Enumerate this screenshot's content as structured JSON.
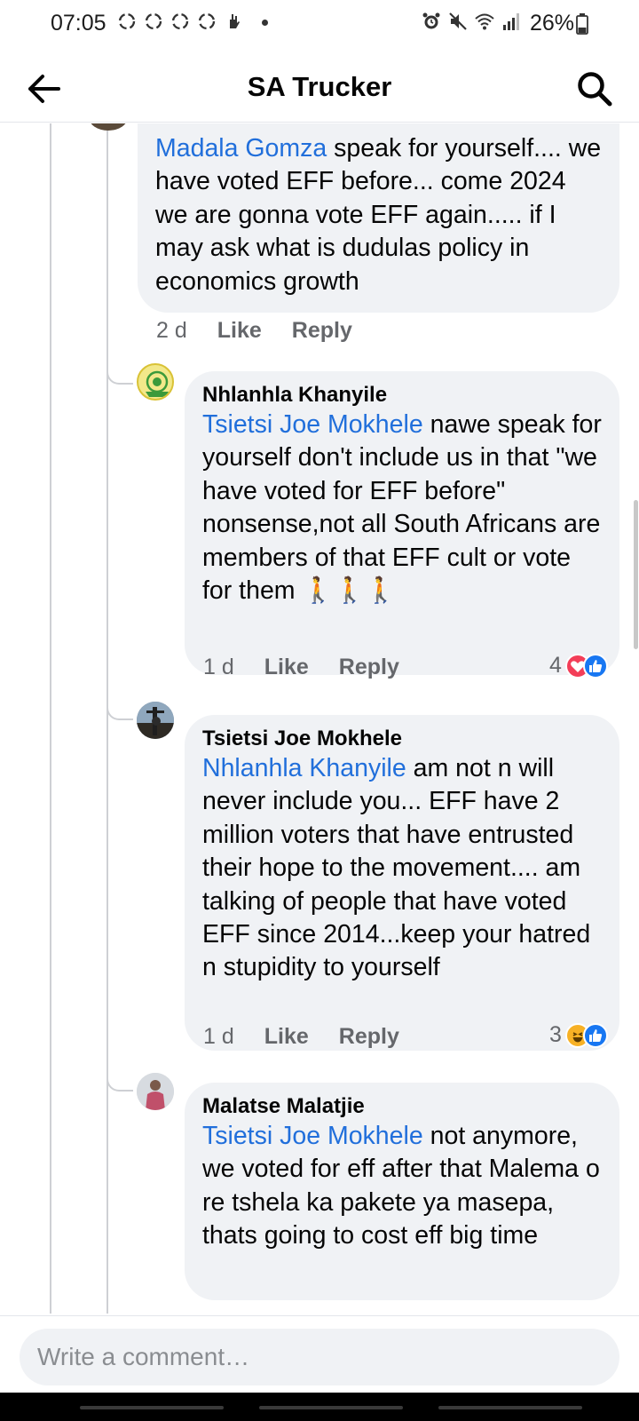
{
  "status_bar": {
    "time": "07:05",
    "battery": "26%",
    "left_icons": [
      "recycle-icon",
      "recycle-icon",
      "recycle-icon",
      "recycle-icon",
      "hand-icon"
    ],
    "right_icons": [
      "alarm-icon",
      "mute-icon",
      "wifi-icon",
      "signal-icon",
      "battery-icon"
    ]
  },
  "header": {
    "title": "SA Trucker"
  },
  "comments": [
    {
      "author": "",
      "mention": "Madala Gomza",
      "text": "  speak for yourself.... we have voted EFF before... come 2024 we are gonna vote EFF again..... if I may ask what is dudulas policy in economics growth",
      "time": "2 d",
      "like": "Like",
      "reply": "Reply"
    },
    {
      "author": "Nhlanhla Khanyile",
      "mention": "Tsietsi Joe Mokhele",
      "text": " nawe speak for yourself don't include us in that \"we have voted for EFF before\" nonsense,not all South Africans are members of that EFF cult or vote for them 🚶🚶🚶",
      "time": "1 d",
      "like": "Like",
      "reply": "Reply",
      "reaction_count": "4",
      "reactions": [
        "love-icon",
        "like-icon"
      ]
    },
    {
      "author": "Tsietsi Joe Mokhele",
      "mention": "Nhlanhla Khanyile",
      "text": "  am not n will never include you... EFF have 2 million voters that have entrusted their hope to the movement.... am talking of people that have voted EFF since 2014...keep your hatred n stupidity to yourself",
      "time": "1 d",
      "like": "Like",
      "reply": "Reply",
      "reaction_count": "3",
      "reactions": [
        "haha-icon",
        "like-icon"
      ]
    },
    {
      "author": "Malatse Malatjie",
      "mention": "Tsietsi Joe Mokhele",
      "text": " not anymore, we voted for eff after that Malema o re tshela ka pakete ya masepa, thats going to cost eff big time"
    }
  ],
  "composer": {
    "placeholder": "Write a comment…"
  },
  "colors": {
    "mention": "#216fdb",
    "bubble": "#f0f2f5",
    "meta": "#65676b",
    "love": "#f33e58",
    "like": "#1877f2",
    "haha": "#f7b125"
  }
}
